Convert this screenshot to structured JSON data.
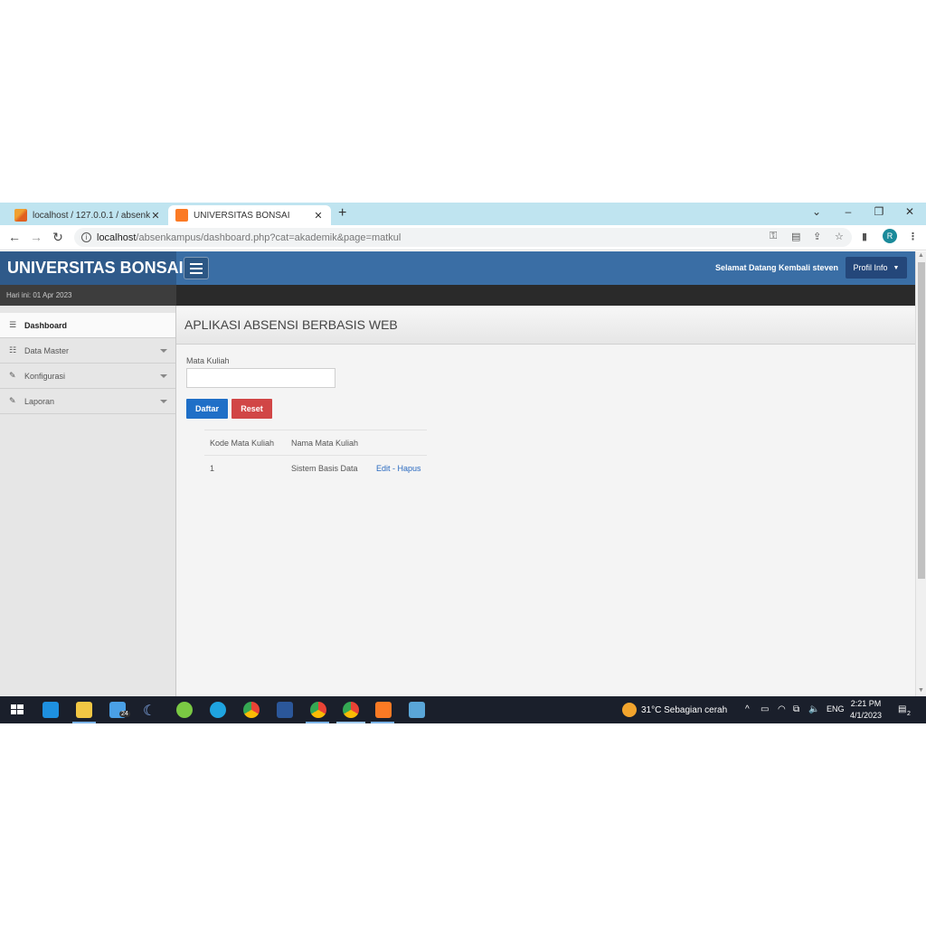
{
  "browser": {
    "tabs": [
      {
        "title": "localhost / 127.0.0.1 / absenkamp",
        "active": false
      },
      {
        "title": "UNIVERSITAS BONSAI",
        "active": true
      }
    ],
    "url_host": "localhost",
    "url_path": "/absenkampus/dashboard.php?cat=akademik&page=matkul",
    "avatar_letter": "R"
  },
  "header": {
    "brand": "UNIVERSITAS BONSAI",
    "welcome": "Selamat Datang Kembali steven",
    "profile_label": "Profil Info"
  },
  "date_bar": "Hari ini: 01 Apr 2023",
  "sidebar": {
    "items": [
      {
        "label": "Dashboard",
        "icon": "list-icon"
      },
      {
        "label": "Data Master",
        "icon": "list-icon"
      },
      {
        "label": "Konfigurasi",
        "icon": "pencil-icon"
      },
      {
        "label": "Laporan",
        "icon": "pencil-icon"
      }
    ]
  },
  "main": {
    "page_title": "APLIKASI ABSENSI BERBASIS WEB",
    "field_label": "Mata Kuliah",
    "field_value": "",
    "submit_label": "Daftar",
    "reset_label": "Reset",
    "table": {
      "headers": [
        "Kode Mata Kuliah",
        "Nama Mata Kuliah"
      ],
      "rows": [
        {
          "kode": "1",
          "nama": "Sistem Basis Data",
          "action": "Edit - Hapus"
        }
      ]
    }
  },
  "taskbar": {
    "mail_badge": "24",
    "weather": "31°C  Sebagian cerah",
    "lang": "ENG",
    "time": "2:21 PM",
    "date": "4/1/2023",
    "notif_count": "2"
  },
  "colors": {
    "header": "#3a6ea5",
    "brand": "#2f5a8a",
    "submit": "#1f6fc7",
    "reset": "#d14646"
  }
}
